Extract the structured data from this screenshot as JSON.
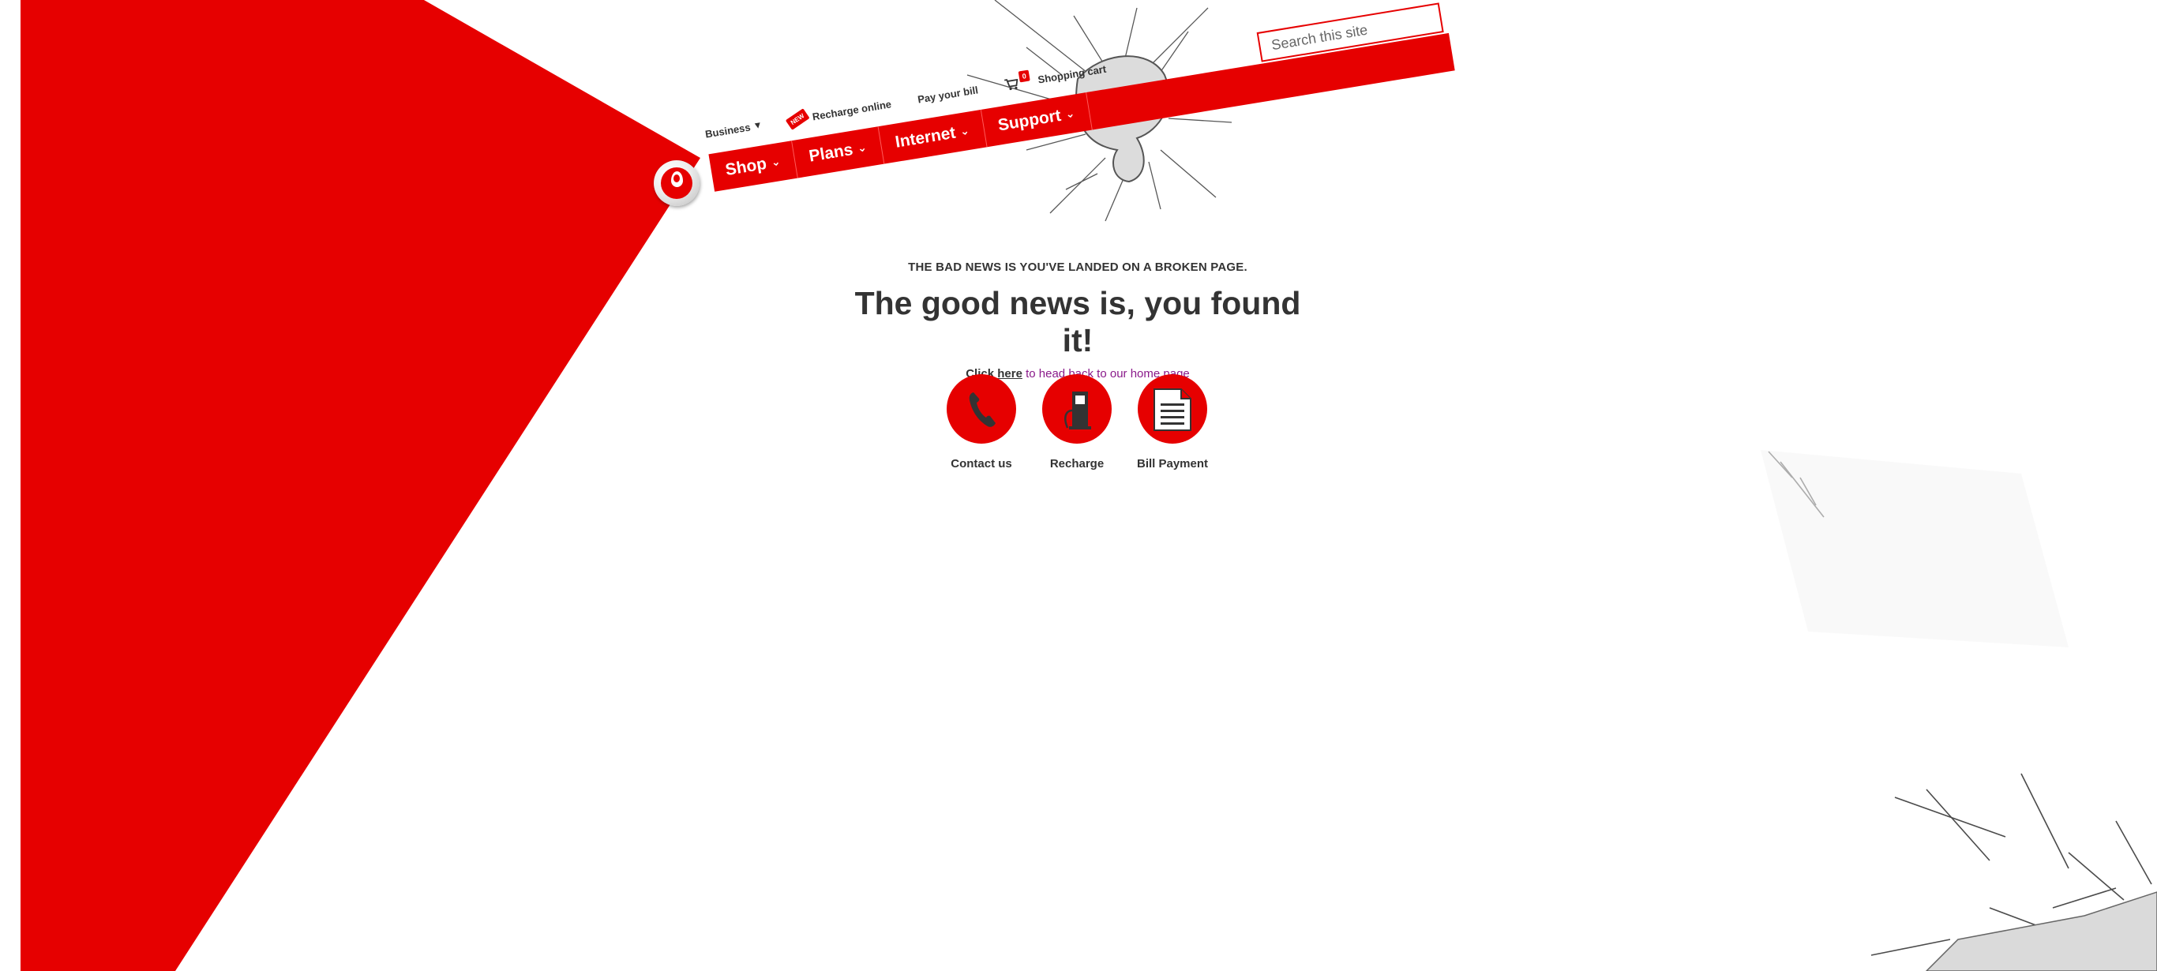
{
  "brand": {
    "logo": "vodafone-logo",
    "accent_color": "#e60000"
  },
  "utility_nav": {
    "business_label": "Business",
    "new_badge": "NEW",
    "recharge_label": "Recharge online",
    "pay_bill_label": "Pay your bill",
    "cart_count": "0",
    "cart_label": "Shopping cart"
  },
  "main_nav": {
    "items": [
      {
        "label": "Shop"
      },
      {
        "label": "Plans"
      },
      {
        "label": "Internet"
      },
      {
        "label": "Support"
      }
    ]
  },
  "search": {
    "placeholder": "Search this site"
  },
  "message": {
    "eyebrow": "THE BAD NEWS IS YOU'VE LANDED ON A BROKEN PAGE.",
    "headline": "The good news is, you found it!",
    "link_label": "Click here",
    "link_suffix": " to head back to our home page"
  },
  "quick_links": [
    {
      "label": "Contact us",
      "icon": "phone-icon"
    },
    {
      "label": "Recharge",
      "icon": "fuel-pump-icon"
    },
    {
      "label": "Bill Payment",
      "icon": "document-icon"
    }
  ]
}
